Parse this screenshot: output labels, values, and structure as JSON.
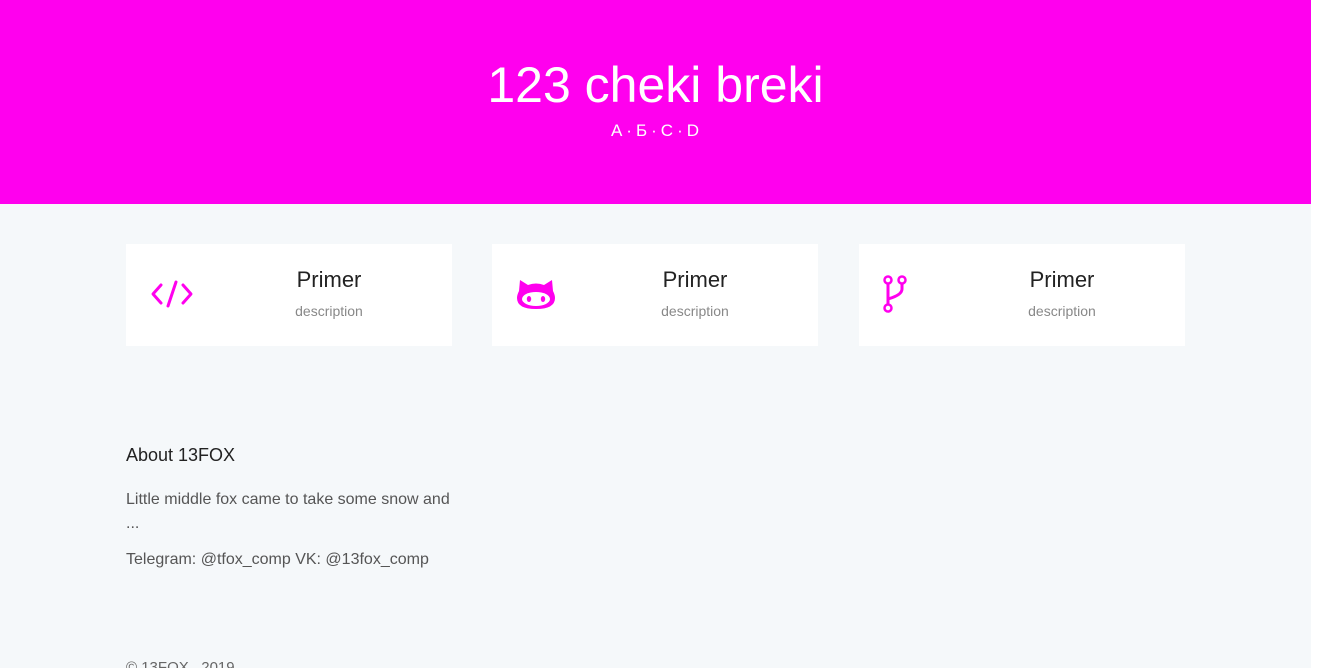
{
  "hero": {
    "title": "123 cheki breki",
    "nav": [
      "А",
      "Б",
      "С",
      "D"
    ],
    "nav_separator": "·",
    "background": "#ff00ee"
  },
  "cards": [
    {
      "icon": "code-icon",
      "title": "Primer",
      "description": "description"
    },
    {
      "icon": "github-octocat-icon",
      "title": "Primer",
      "description": "description"
    },
    {
      "icon": "git-branch-icon",
      "title": "Primer",
      "description": "description"
    }
  ],
  "about": {
    "title": "About 13FOX",
    "text": "Little middle fox came to take some snow and ...",
    "contacts": "Telegram: @tfox_comp VK: @13fox_comp"
  },
  "footer": {
    "text": "© 13FOX , 2019"
  },
  "colors": {
    "accent": "#ff00ee",
    "page_background": "#f5f8fa",
    "card_background": "#ffffff"
  }
}
